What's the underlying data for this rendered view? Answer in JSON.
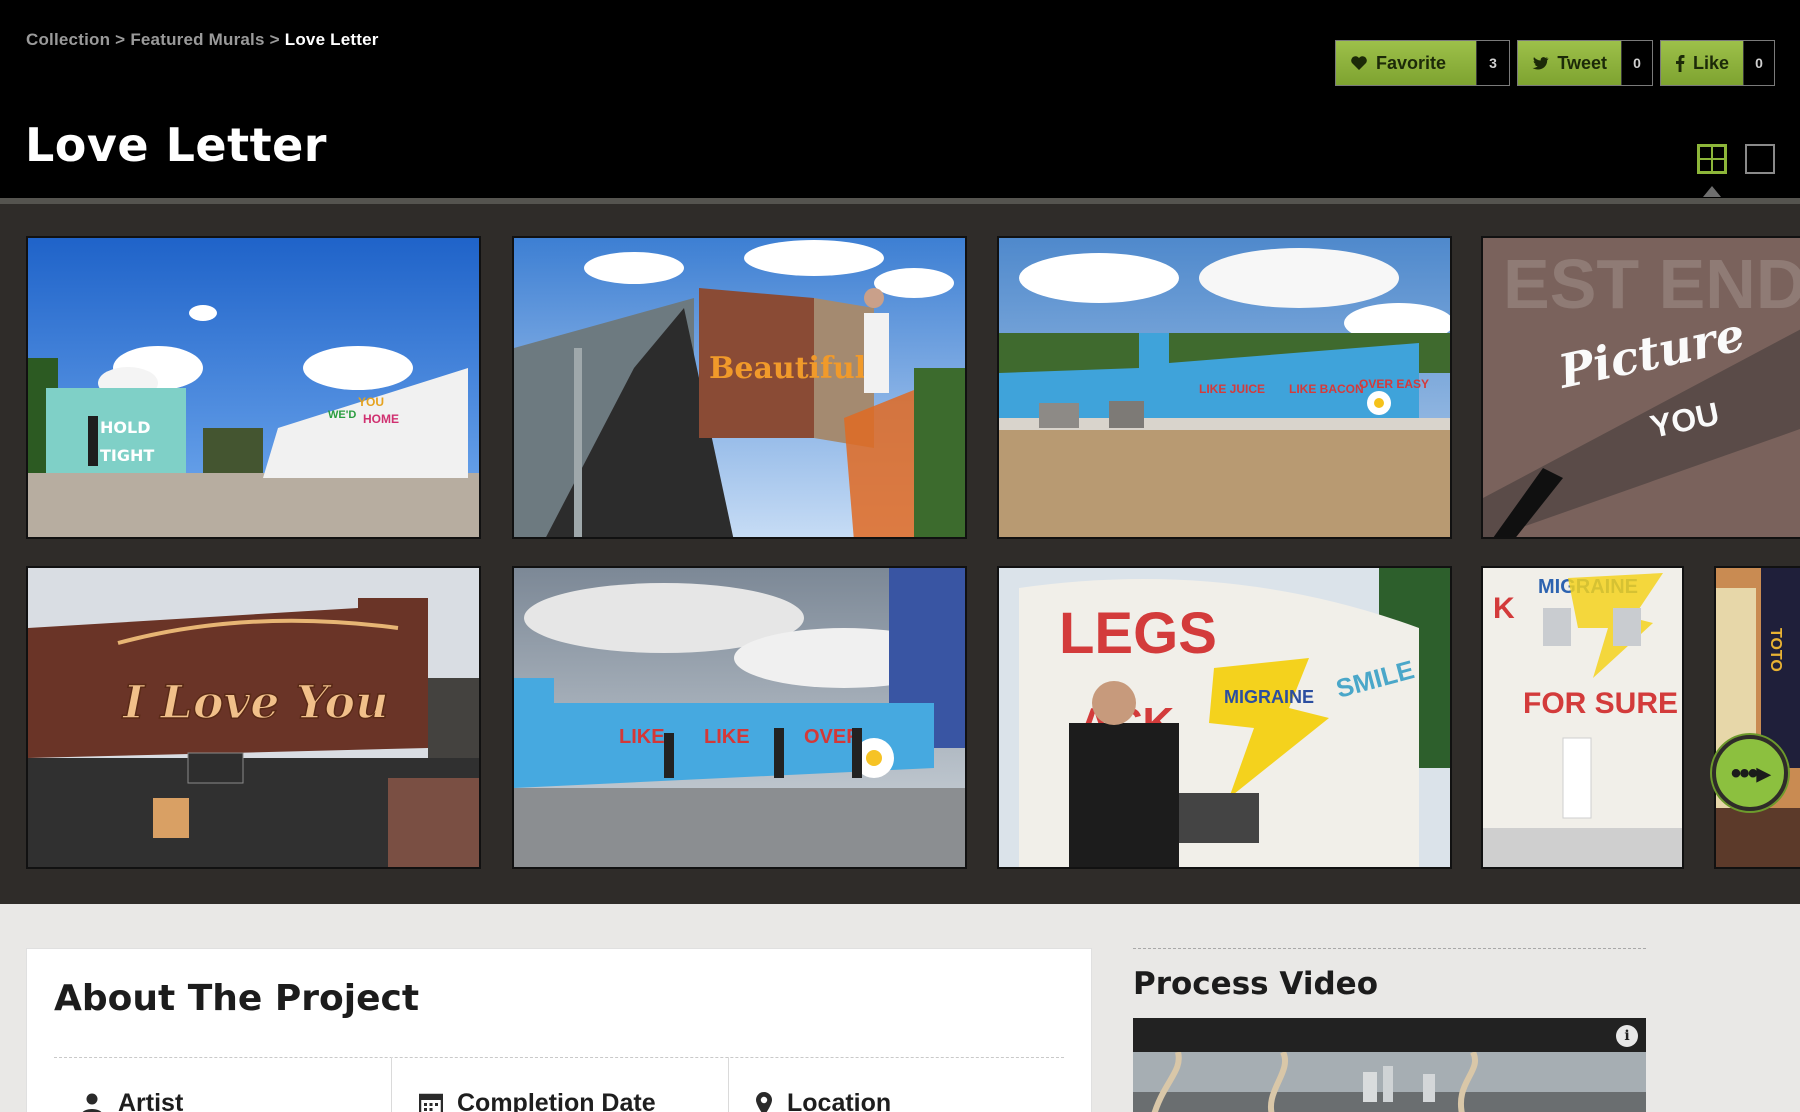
{
  "breadcrumb": {
    "items": [
      "Collection",
      "Featured Murals"
    ],
    "separator": ">",
    "current": "Love Letter"
  },
  "page_title": "Love Letter",
  "share": {
    "favorite_label": "Favorite",
    "favorite_count": "3",
    "tweet_label": "Tweet",
    "tweet_count": "0",
    "like_label": "Like",
    "like_count": "0"
  },
  "view_toggle": {
    "grid_icon": "grid-view-icon",
    "single_icon": "single-view-icon",
    "active": "grid"
  },
  "gallery": {
    "images": [
      {
        "subject": "Hold Tight mural on empty lot"
      },
      {
        "subject": "Artist painting See Me Like Beautiful from lift"
      },
      {
        "subject": "Rooftop mural I Need You Like Juice"
      },
      {
        "subject": "Picture You mural on brick wall"
      },
      {
        "subject": "I Love You mural on brick building"
      },
      {
        "subject": "Painters on rooftop blue wall"
      },
      {
        "subject": "Artist on lift beside Legs mural"
      },
      {
        "subject": "For Sure Migraine mural on rowhouse"
      },
      {
        "subject": "Colorful storefront facade"
      }
    ],
    "more_label": "•••▸",
    "more_icon": "more-arrow-icon"
  },
  "about": {
    "title": "About The Project",
    "meta": [
      {
        "label": "Artist",
        "icon": "person-icon"
      },
      {
        "label": "Completion Date",
        "icon": "calendar-icon"
      },
      {
        "label": "Location",
        "icon": "map-pin-icon"
      }
    ]
  },
  "video": {
    "title": "Process Video",
    "info_label": "i"
  },
  "colors": {
    "accent_green": "#8cc03f",
    "header_bg": "#000000",
    "gallery_bg": "#2f2c29",
    "content_bg": "#e9e8e6"
  }
}
